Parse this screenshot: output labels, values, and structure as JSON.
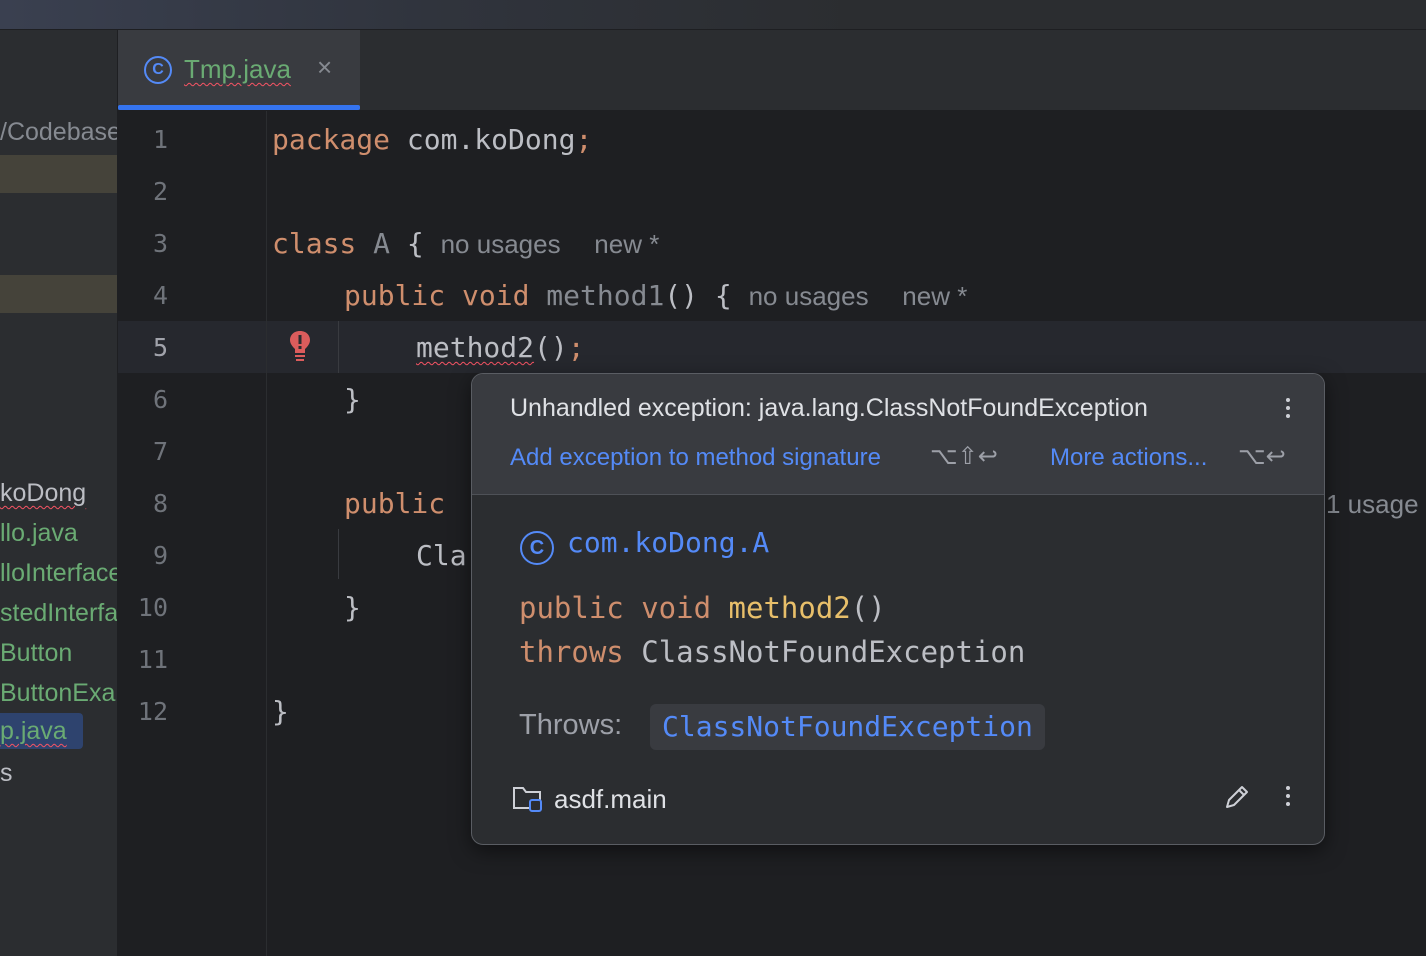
{
  "sidebar": {
    "path_fragment": "/Codebase",
    "items": [
      {
        "label": "koDong",
        "y": 0
      },
      {
        "label": "llo.java"
      },
      {
        "label": "lloInterface"
      },
      {
        "label": "stedInterface"
      },
      {
        "label": "Button"
      },
      {
        "label": "ButtonExample"
      },
      {
        "label": "p.java"
      },
      {
        "label": "s"
      }
    ]
  },
  "tab": {
    "label": "Tmp.java",
    "icon": "class-icon",
    "close_glyph": "×"
  },
  "editor": {
    "line_numbers": [
      "1",
      "2",
      "3",
      "4",
      "5",
      "6",
      "7",
      "8",
      "9",
      "10",
      "11",
      "12"
    ],
    "current_line": "5",
    "line1": {
      "kw": "package",
      "rest": " com.koDong",
      "semi": ";"
    },
    "line3": {
      "kw": "class",
      "name": " A",
      "brace": " {",
      "hint1": "no usages",
      "hint2": "new *"
    },
    "line4": {
      "kw": "public void",
      "name": " method1",
      "rest": "() {",
      "hint1": "no usages",
      "hint2": "new *"
    },
    "line5": {
      "call": "method2",
      "rest": "()",
      "semi": ";"
    },
    "line6": "}",
    "line8": {
      "kw": "public"
    },
    "line8_hint": "1 usage",
    "line9": "Cla",
    "line10": "}",
    "line12": "}"
  },
  "popup": {
    "error": "Unhandled exception: java.lang.ClassNotFoundException",
    "fix_action": "Add exception to method signature",
    "fix_shortcut": "⌥⇧↩",
    "more_actions": "More actions...",
    "more_shortcut": "⌥↩",
    "class_name": "com.koDong.A",
    "sig_kw": "public void",
    "sig_method": "method2",
    "sig_parens": "()",
    "sig_throws_kw": "throws",
    "sig_throws_type": "ClassNotFoundException",
    "throws_label": "Throws:",
    "throws_link": "ClassNotFoundException",
    "module": "asdf.main"
  },
  "colors": {
    "accent": "#3574f0",
    "link": "#548af7",
    "keyword": "#cf8e6d",
    "string_green": "#6aab73",
    "error": "#f75464"
  }
}
